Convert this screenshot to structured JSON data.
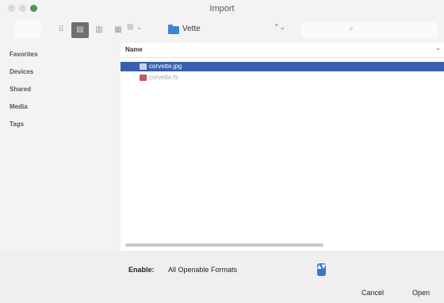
{
  "window": {
    "title": "Import"
  },
  "toolbar": {
    "view_buttons": [
      "⠿",
      "▤",
      "▥",
      "▦"
    ],
    "arrange_label": "⊞ ⌄",
    "folder": "Vette",
    "folder_chevron": "⌃⌄",
    "search_icon": "⌕",
    "search_value": ""
  },
  "sidebar": {
    "items": [
      {
        "label": "Favorites"
      },
      {
        "label": "Devices"
      },
      {
        "label": "Shared"
      },
      {
        "label": "Media"
      },
      {
        "label": "Tags"
      }
    ]
  },
  "file_list": {
    "column_header": "Name",
    "sort_icon": "⌄",
    "files": [
      {
        "name": "corvette.jpg",
        "selected": true
      },
      {
        "name": "corvette.fs",
        "selected": false
      }
    ]
  },
  "footer": {
    "enable_label": "Enable:",
    "enable_value": "All Openable Formats",
    "stepper_glyph": "▲▼",
    "cancel_label": "Cancel",
    "open_label": "Open"
  },
  "colors": {
    "accent": "#3a5fb0",
    "folder": "#3d86d6",
    "stepper": "#3a73c9"
  }
}
